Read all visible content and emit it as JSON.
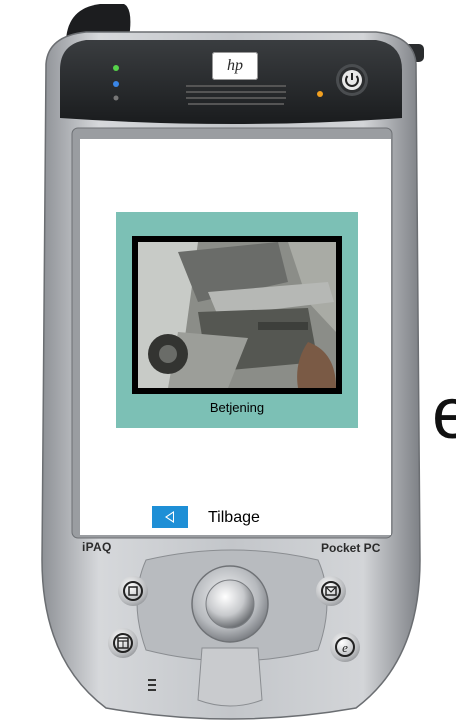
{
  "device": {
    "logo": "hp",
    "brand_left": "iPAQ",
    "brand_right": "Pocket PC"
  },
  "screen": {
    "video_caption": "Betjening",
    "back_label": "Tilbage"
  },
  "colors": {
    "panel": "#7cc0b5",
    "back_button": "#1e8fd6"
  },
  "icons": {
    "back": "left-arrow-icon",
    "power": "power-icon",
    "contacts": "contacts-icon",
    "mail": "mail-icon",
    "calendar": "calendar-icon",
    "internet": "internet-explorer-icon"
  }
}
